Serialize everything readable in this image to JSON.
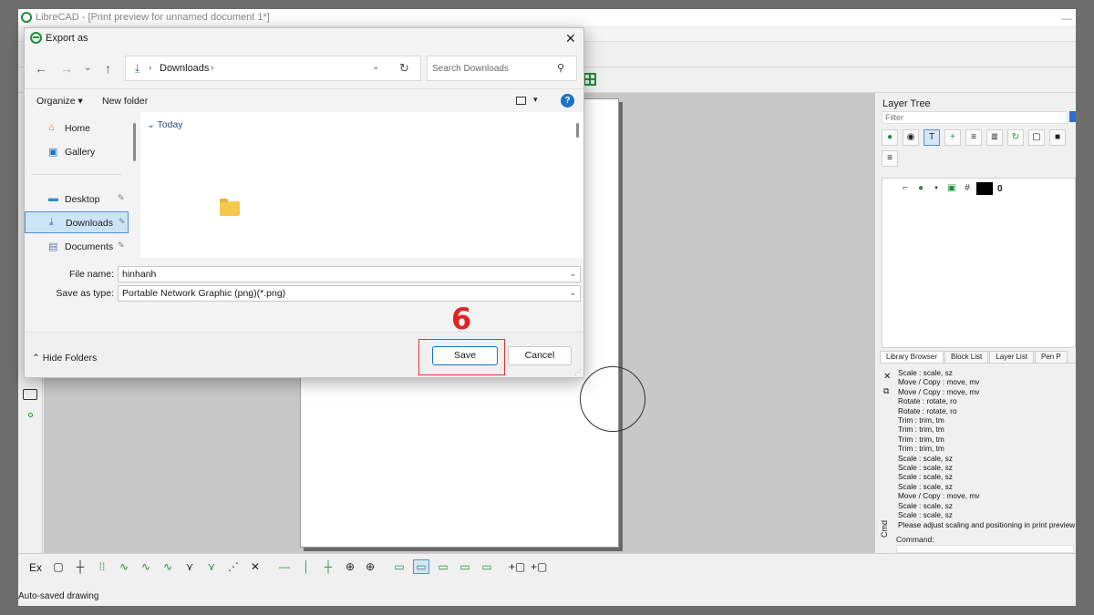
{
  "app": {
    "title": "LibreCAD - [Print preview for unnamed document 1*]",
    "status_text": "Auto-saved drawing"
  },
  "layer_tree": {
    "header": "Layer Tree",
    "filter_placeholder": "Filter",
    "layer_name": "0",
    "tabs": [
      "Library Browser",
      "Block List",
      "Layer List",
      "Pen P"
    ]
  },
  "command_panel": {
    "side_label": "Cmd",
    "history": [
      "Scale : scale, sz",
      "Move / Copy : move, mv",
      "Move / Copy : move, mv",
      "Rotate : rotate, ro",
      "Rotate : rotate, ro",
      "Trim : trim, tm",
      "Trim : trim, tm",
      "Trim : trim, tm",
      "Trim : trim, tm",
      "Scale : scale, sz",
      "Scale : scale, sz",
      "Scale : scale, sz",
      "Scale : scale, sz",
      "Move / Copy : move, mv",
      "Scale : scale, sz",
      "Scale : scale, sz",
      "Please adjust scaling and positioning in print preview"
    ],
    "command_label": "Command:"
  },
  "bottom_toolbar": {
    "ex_label": "Ex"
  },
  "dialog": {
    "title": "Export as",
    "breadcrumb": "Downloads",
    "search_placeholder": "Search Downloads",
    "organize_label": "Organize",
    "new_folder_label": "New folder",
    "help_label": "?",
    "nav_items": [
      {
        "label": "Home",
        "icon": "home-icon"
      },
      {
        "label": "Gallery",
        "icon": "gallery-icon"
      },
      {
        "label": "Desktop",
        "icon": "desktop-icon"
      },
      {
        "label": "Downloads",
        "icon": "download-icon"
      },
      {
        "label": "Documents",
        "icon": "documents-icon"
      }
    ],
    "group_header": "Today",
    "file_name_label": "File name:",
    "file_name_value": "hinhanh",
    "save_type_label": "Save as type:",
    "save_type_value": "Portable Network Graphic (png)(*.png)",
    "hide_folders_label": "Hide Folders",
    "save_label": "Save",
    "cancel_label": "Cancel"
  },
  "annotation": {
    "step_number": "6",
    "color": "#e02424"
  }
}
